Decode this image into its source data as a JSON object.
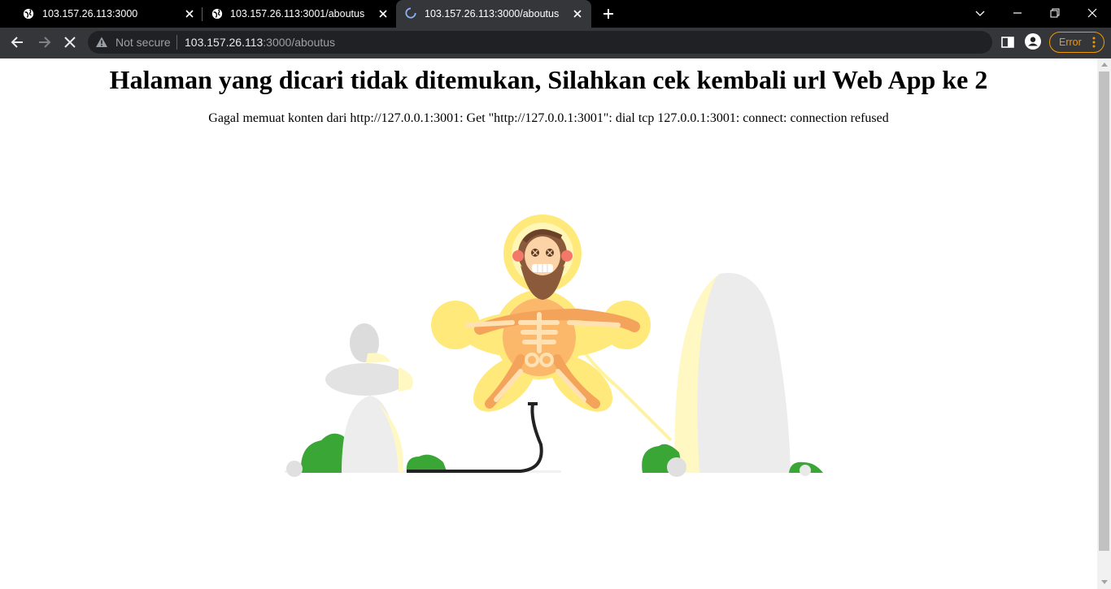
{
  "browser": {
    "tabs": [
      {
        "title": "103.157.26.113:3000",
        "state": "inactive"
      },
      {
        "title": "103.157.26.113:3001/aboutus",
        "state": "inactive"
      },
      {
        "title": "103.157.26.113:3000/aboutus",
        "state": "active-loading"
      }
    ],
    "security_label": "Not secure",
    "url_host": "103.157.26.113",
    "url_path": ":3000/aboutus",
    "profile_error_label": "Error",
    "icons": [
      "back-icon",
      "forward-icon",
      "stop-icon",
      "warning-icon",
      "translate-icon",
      "share-icon",
      "bookmark-star-icon",
      "side-panel-icon",
      "profile-icon",
      "kebab-menu-icon",
      "tab-search-icon",
      "minimize-icon",
      "restore-icon",
      "close-window-icon",
      "new-tab-icon"
    ]
  },
  "page": {
    "heading": "Halaman yang dicari tidak ditemukan, Silahkan cek kembali url Web App ke 2",
    "message": "Gagal memuat konten dari http://127.0.0.1:3001: Get \"http://127.0.0.1:3001\": dial tcp 127.0.0.1:3001: connect: connection refused",
    "illustration": "electrocuted-skeleton-caveman"
  },
  "colors": {
    "tabstrip": "#000000",
    "toolbar": "#35363a",
    "omnibox": "#202124",
    "error_accent": "#f29900",
    "loading_spinner": "#8ab4f8",
    "glow": "#ffe97a",
    "plant": "#3aa635"
  }
}
